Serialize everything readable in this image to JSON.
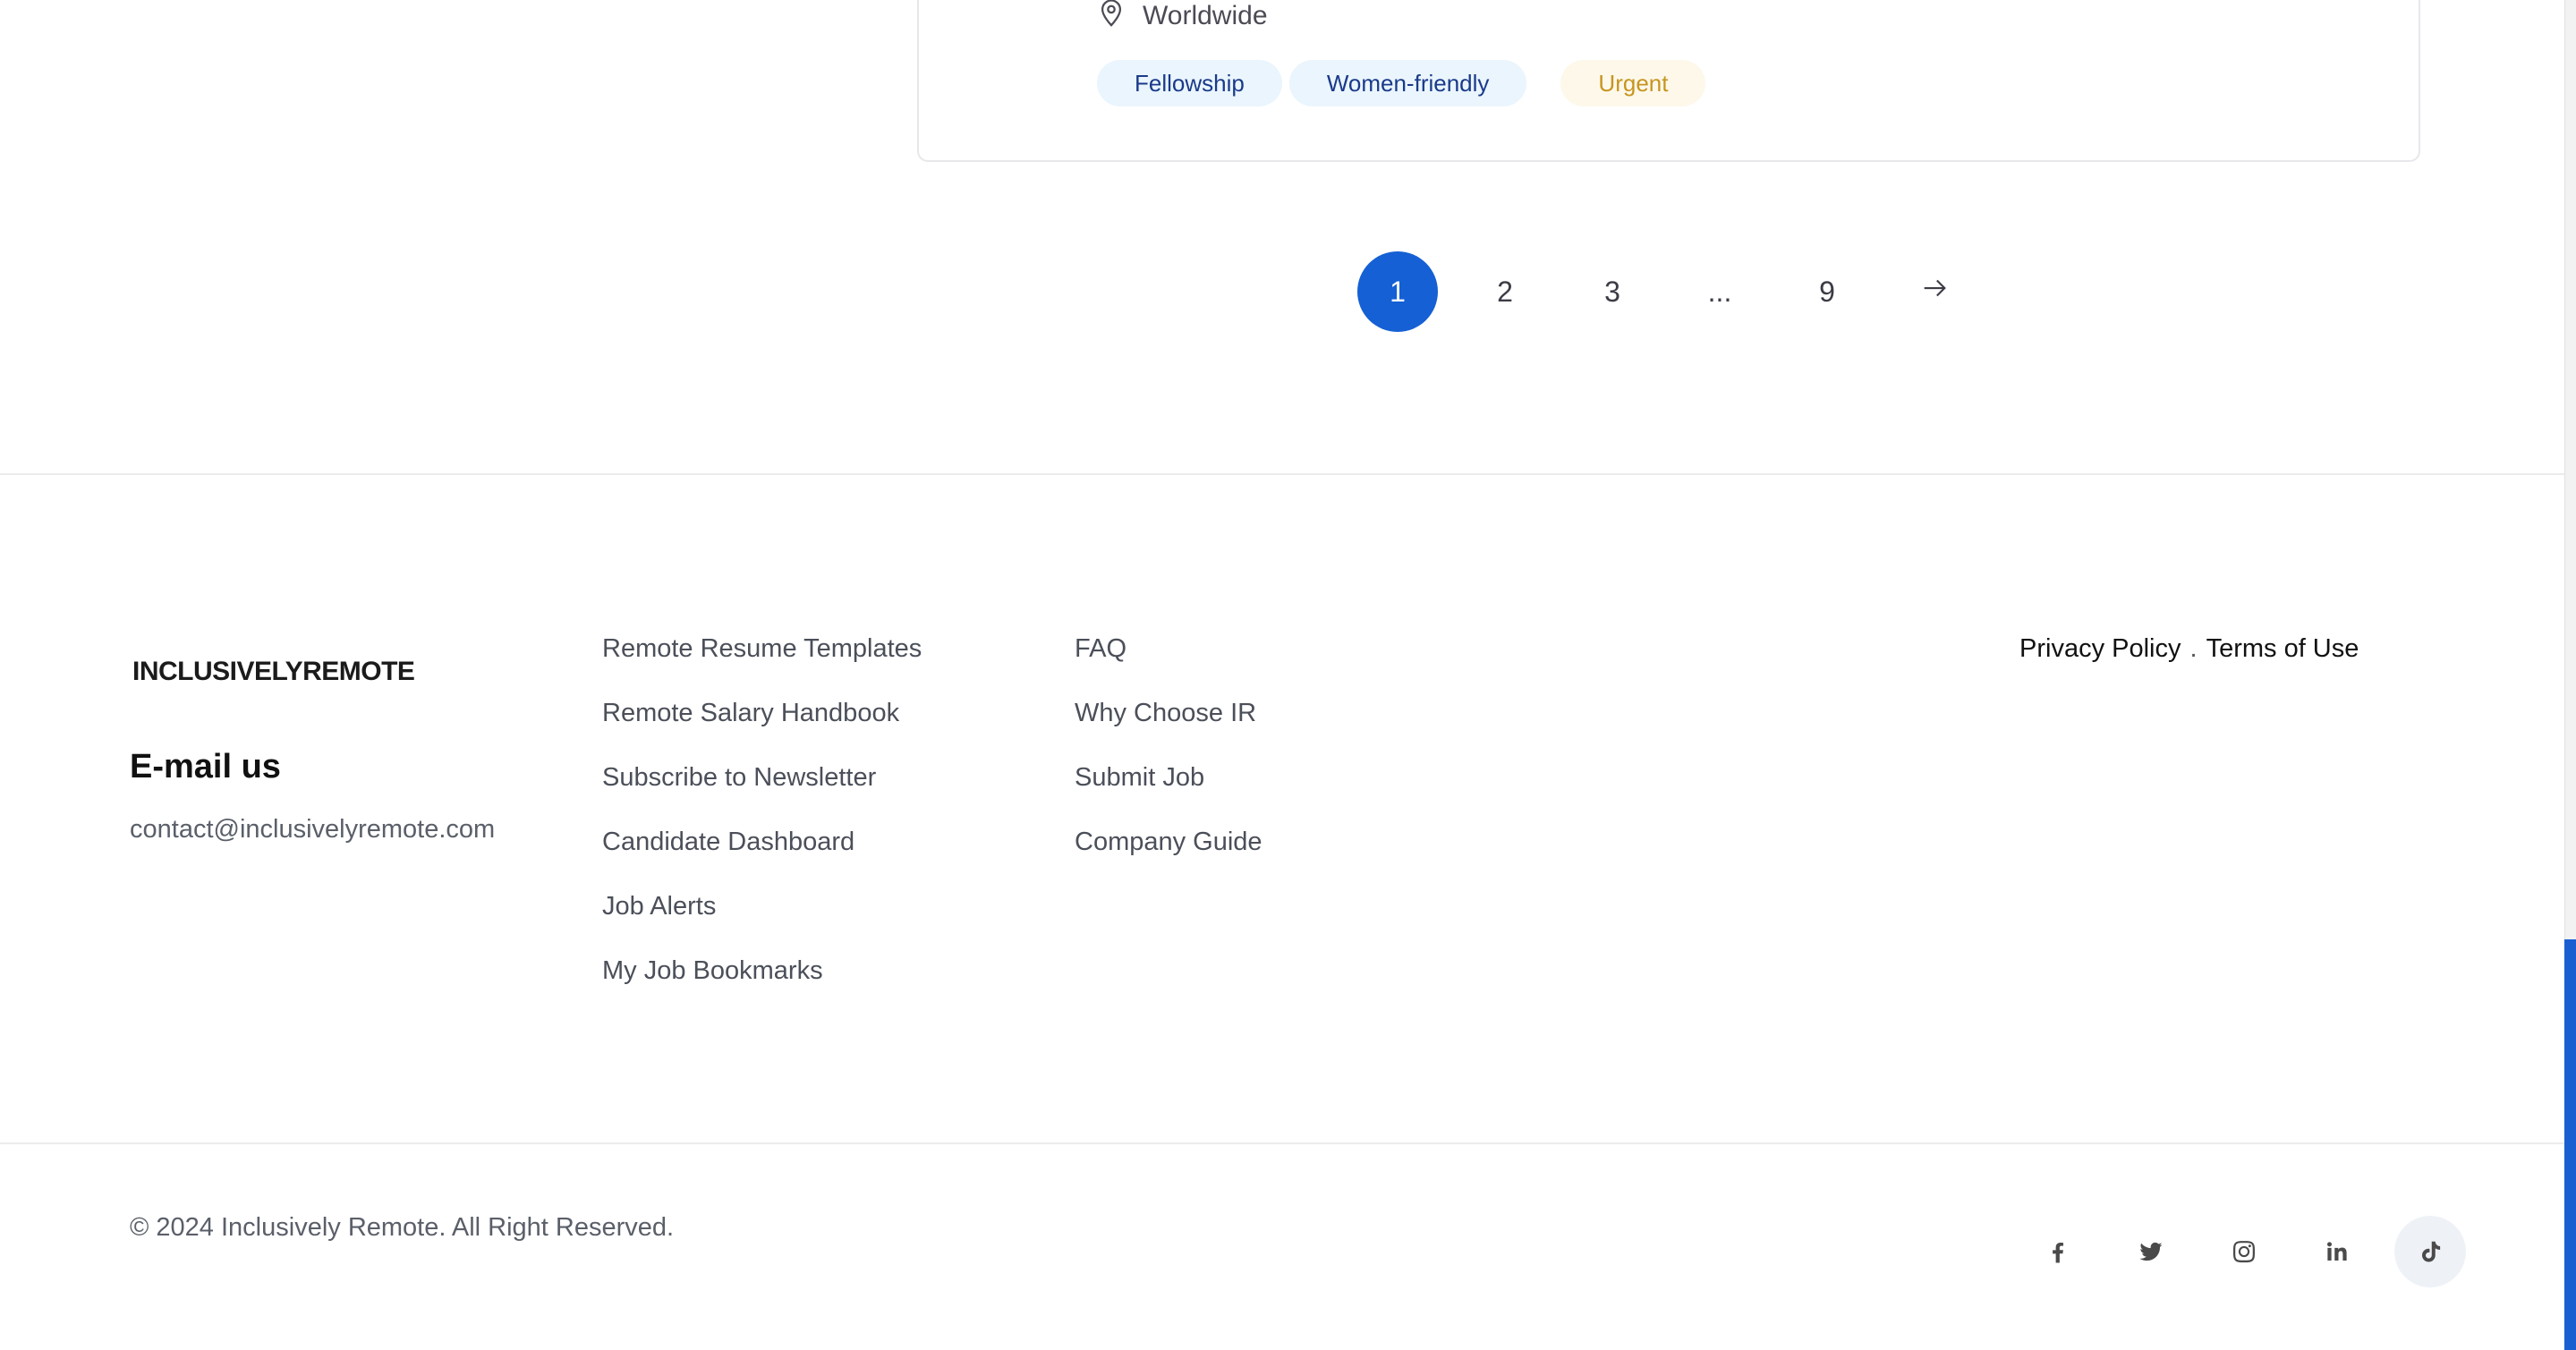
{
  "job_card": {
    "location": "Worldwide",
    "tags": [
      "Fellowship",
      "Women-friendly"
    ],
    "urgent_tag": "Urgent"
  },
  "pagination": {
    "pages": [
      "1",
      "2",
      "3",
      "...",
      "9"
    ],
    "active": "1"
  },
  "footer": {
    "logo": "INCLUSIVELYREMOTE",
    "email_heading": "E-mail us",
    "email": "contact@inclusivelyremote.com",
    "column_1": [
      "Remote Resume Templates",
      "Remote Salary Handbook",
      "Subscribe to Newsletter",
      "Candidate Dashboard",
      "Job Alerts",
      "My Job Bookmarks"
    ],
    "column_2": [
      "FAQ",
      "Why Choose IR",
      "Submit Job",
      "Company Guide"
    ],
    "legal": {
      "privacy": "Privacy Policy",
      "separator": ".",
      "terms": "Terms of Use"
    },
    "copyright": "© 2024 Inclusively Remote. All Right Reserved.",
    "social_icons": [
      "facebook-icon",
      "twitter-icon",
      "instagram-icon",
      "linkedin-icon",
      "tiktok-icon"
    ]
  },
  "colors": {
    "accent": "#1560d4",
    "tag_blue_bg": "#eaf5fd",
    "tag_blue_text": "#1a3a8a",
    "urgent_bg": "#fdf8ea",
    "urgent_text": "#c79520"
  }
}
